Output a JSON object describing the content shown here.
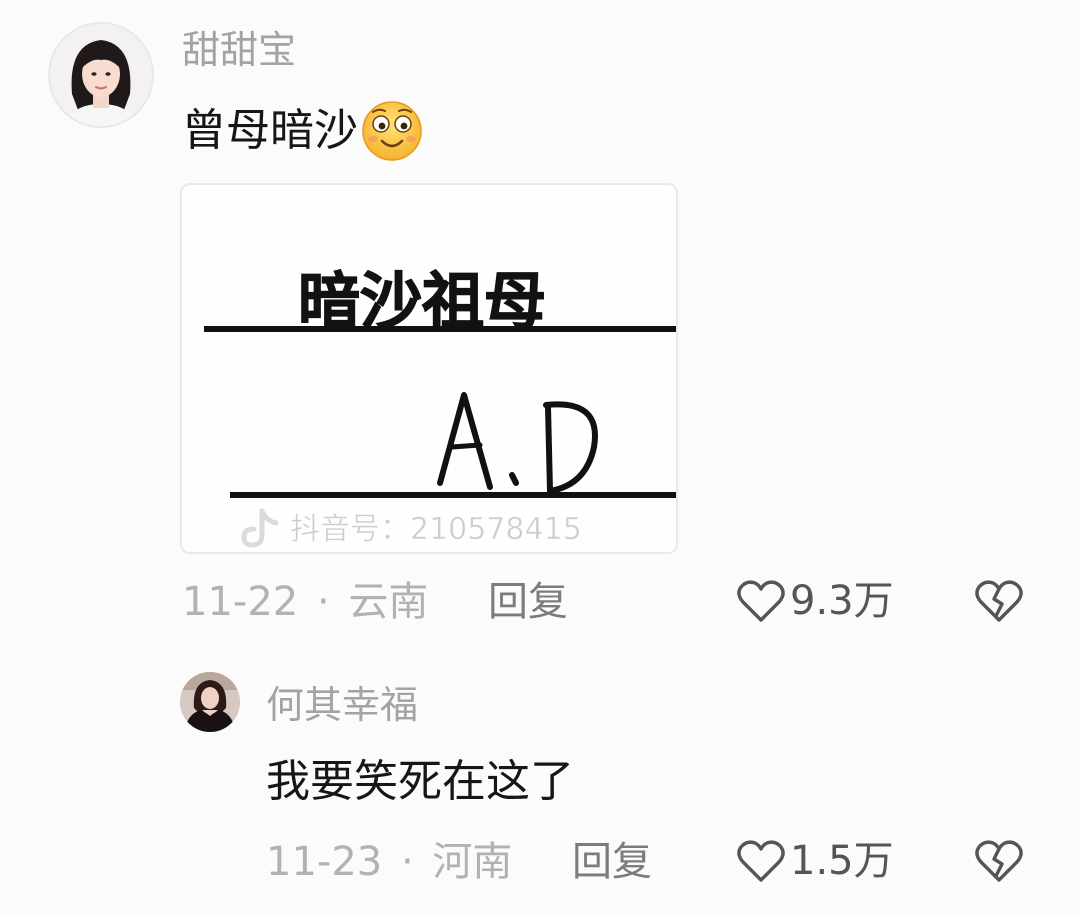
{
  "comments": [
    {
      "username": "甜甜宝",
      "text": "曾母暗沙",
      "emoji": "smiling-face-emoji",
      "attachment": {
        "handwriting_top": "暗沙祖母",
        "handwriting_bottom": "A.D",
        "watermark": "抖音号：210578415"
      },
      "date": "11-22",
      "separator": "·",
      "location": "云南",
      "reply_label": "回复",
      "like_icon": "heart-outline-icon",
      "likes": "9.3万",
      "dislike_icon": "broken-heart-icon"
    }
  ],
  "replies": [
    {
      "username": "何其幸福",
      "text": "我要笑死在这了",
      "date": "11-23",
      "separator": "·",
      "location": "河南",
      "reply_label": "回复",
      "like_icon": "heart-outline-icon",
      "likes": "1.5万",
      "dislike_icon": "broken-heart-icon"
    }
  ],
  "colors": {
    "background": "#fbfbfb",
    "username": "#a3a3a3",
    "text": "#161616",
    "meta": "#b2b2b2",
    "reply": "#7c7c7c",
    "icon": "#555555"
  }
}
